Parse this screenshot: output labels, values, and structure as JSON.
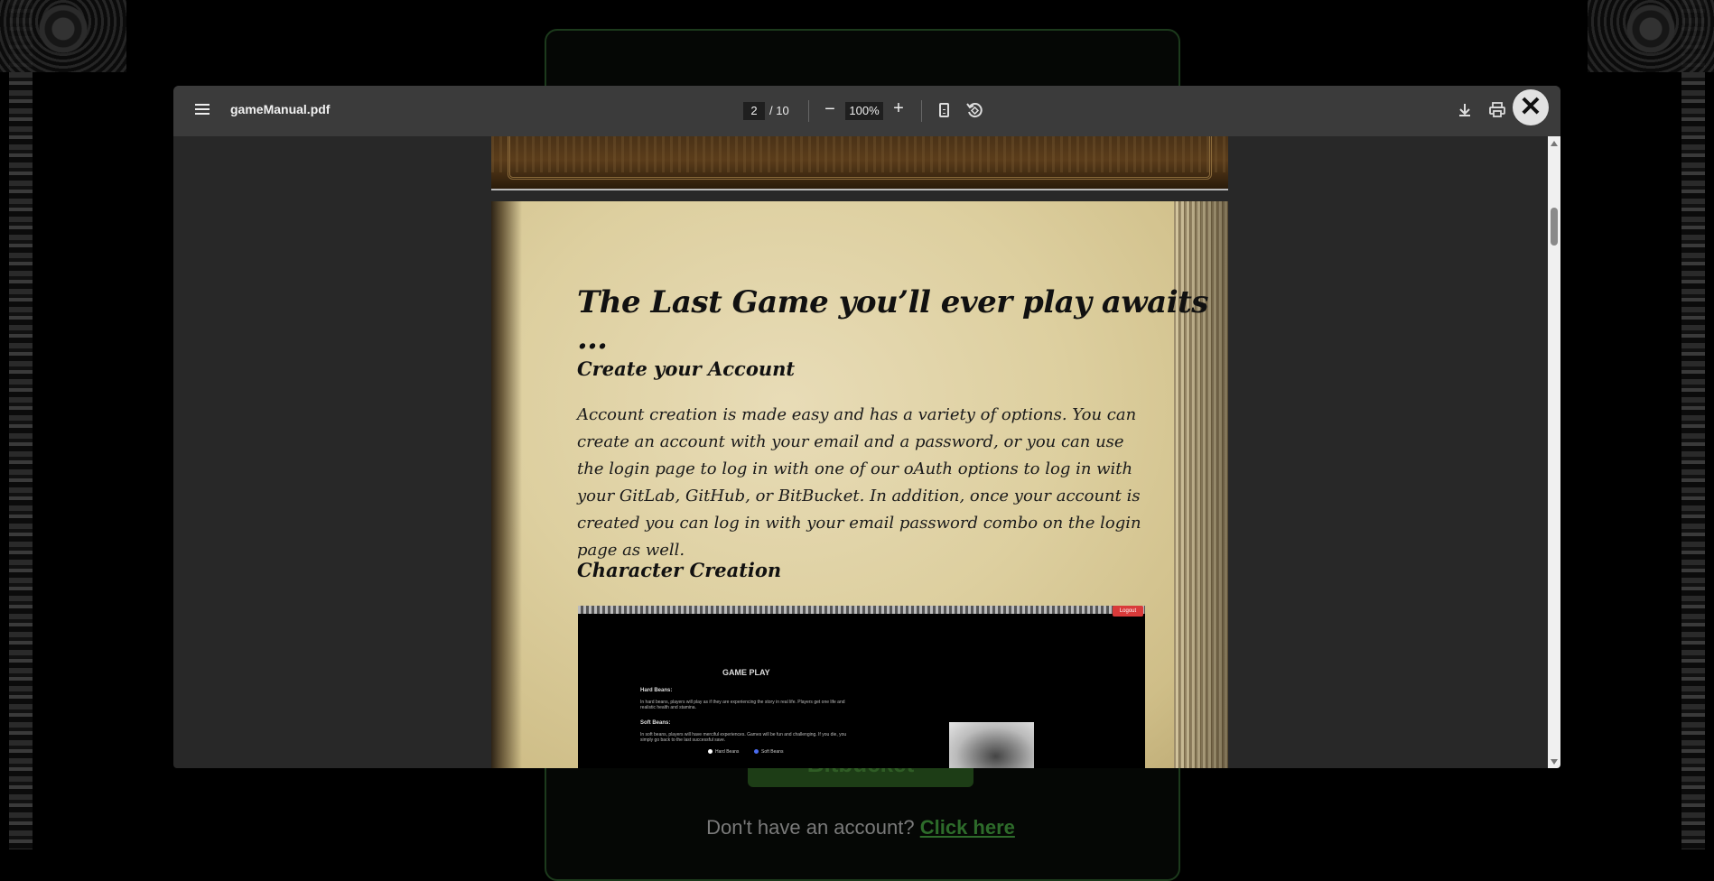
{
  "background": {
    "bitbucket_label": "Bitbucket",
    "signup_prompt": "Don't have an account?",
    "signup_link": "Click here"
  },
  "viewer": {
    "file_name": "gameManual.pdf",
    "current_page": "2",
    "total_pages": "/ 10",
    "zoom": "100%",
    "zoom_out": "−",
    "zoom_in": "+",
    "close": "✕"
  },
  "page": {
    "title": "The Last Game you’ll ever play awaits …",
    "section1_heading": "Create your Account",
    "section1_body": "Account creation is made easy and has a variety of options. You can create an account with your email and a password, or you can use the login page to log in with one of our oAuth options to log in with your GitLab, GitHub, or BitBucket. In addition, once your account is created you can log in with your email password combo on the login page as well.",
    "section2_heading": "Character Creation",
    "screenshot": {
      "logout": "Logout",
      "title": "GAME PLAY",
      "hard_heading": "Hard Beans:",
      "hard_text": "In hard beans, players will play as if they are experiencing the story in real life. Players get one life and realistic health and stamina.",
      "soft_heading": "Soft Beans:",
      "soft_text": "In soft beans, players will have merciful experiences. Games will be fun and challenging. If you die, you simply go back to the last successful save.",
      "option_hard": "Hard Beans",
      "option_soft": "Soft Beans"
    }
  }
}
